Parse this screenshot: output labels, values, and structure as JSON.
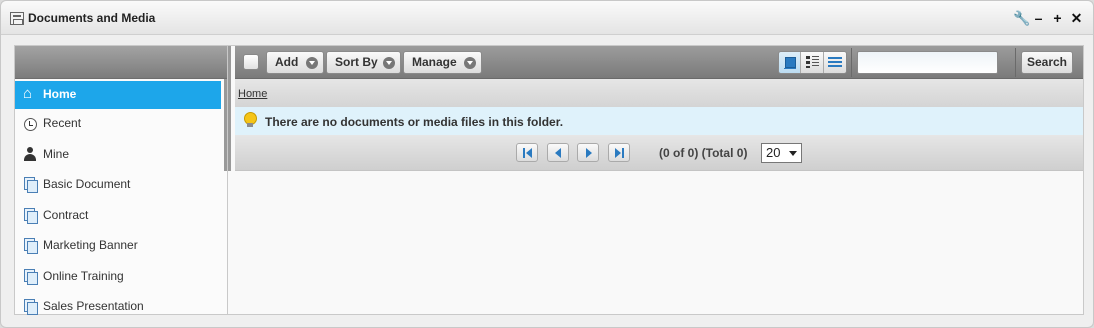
{
  "window": {
    "title": "Documents and Media"
  },
  "sidebar": {
    "items": [
      {
        "label": "Home",
        "icon": "home-icon",
        "active": true
      },
      {
        "label": "Recent",
        "icon": "clock-icon"
      },
      {
        "label": "Mine",
        "icon": "user-icon"
      },
      {
        "label": "Basic Document",
        "icon": "document-type-icon"
      },
      {
        "label": "Contract",
        "icon": "document-type-icon"
      },
      {
        "label": "Marketing Banner",
        "icon": "document-type-icon"
      },
      {
        "label": "Online Training",
        "icon": "document-type-icon"
      },
      {
        "label": "Sales Presentation",
        "icon": "document-type-icon"
      }
    ]
  },
  "toolbar": {
    "add_label": "Add",
    "sort_label": "Sort By",
    "manage_label": "Manage",
    "search_value": "",
    "search_button": "Search",
    "active_view": "icon"
  },
  "breadcrumb": {
    "home": "Home"
  },
  "message": {
    "text": "There are no documents or media files in this folder."
  },
  "pagination": {
    "info": "(0 of 0) (Total 0)",
    "page_size": "20"
  },
  "colors": {
    "accent": "#1da6ea",
    "info_bg": "#dff2fb"
  }
}
